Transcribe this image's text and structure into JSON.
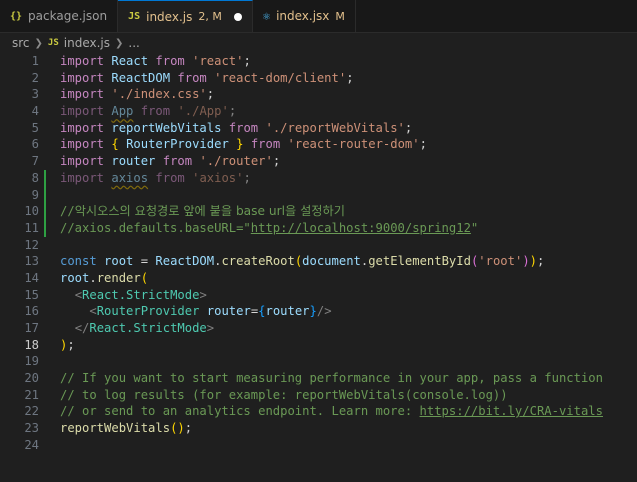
{
  "tabs": [
    {
      "icon": "{}",
      "label": "package.json",
      "badge": ""
    },
    {
      "icon": "JS",
      "label": "index.js",
      "badge": "2, M"
    },
    {
      "icon": "⚛",
      "label": "index.jsx",
      "badge": "M"
    }
  ],
  "breadcrumb": {
    "folder": "src",
    "file_icon": "JS",
    "file": "index.js",
    "more": "..."
  },
  "editor": {
    "current_line": "18",
    "lines": [
      {
        "n": "1",
        "t": [
          [
            "kw",
            "import"
          ],
          [
            "pun",
            " "
          ],
          [
            "id",
            "React"
          ],
          [
            "pun",
            " "
          ],
          [
            "kw",
            "from"
          ],
          [
            "pun",
            " "
          ],
          [
            "str",
            "'react'"
          ],
          [
            "pun",
            ";"
          ]
        ]
      },
      {
        "n": "2",
        "t": [
          [
            "kw",
            "import"
          ],
          [
            "pun",
            " "
          ],
          [
            "id",
            "ReactDOM"
          ],
          [
            "pun",
            " "
          ],
          [
            "kw",
            "from"
          ],
          [
            "pun",
            " "
          ],
          [
            "str",
            "'react-dom/client'"
          ],
          [
            "pun",
            ";"
          ]
        ]
      },
      {
        "n": "3",
        "t": [
          [
            "kw",
            "import"
          ],
          [
            "pun",
            " "
          ],
          [
            "str",
            "'./index.css'"
          ],
          [
            "pun",
            ";"
          ]
        ]
      },
      {
        "n": "4",
        "t": [
          [
            "kw dim",
            "import"
          ],
          [
            "pun dim",
            " "
          ],
          [
            "id dim squig",
            "App"
          ],
          [
            "pun dim",
            " "
          ],
          [
            "kw dim",
            "from"
          ],
          [
            "pun dim",
            " "
          ],
          [
            "str dim",
            "'./App'"
          ],
          [
            "pun dim",
            ";"
          ]
        ]
      },
      {
        "n": "5",
        "t": [
          [
            "kw",
            "import"
          ],
          [
            "pun",
            " "
          ],
          [
            "id",
            "reportWebVitals"
          ],
          [
            "pun",
            " "
          ],
          [
            "kw",
            "from"
          ],
          [
            "pun",
            " "
          ],
          [
            "str",
            "'./reportWebVitals'"
          ],
          [
            "pun",
            ";"
          ]
        ]
      },
      {
        "n": "6",
        "t": [
          [
            "kw",
            "import"
          ],
          [
            "pun",
            " "
          ],
          [
            "br1",
            "{"
          ],
          [
            "pun",
            " "
          ],
          [
            "id",
            "RouterProvider"
          ],
          [
            "pun",
            " "
          ],
          [
            "br1",
            "}"
          ],
          [
            "pun",
            " "
          ],
          [
            "kw",
            "from"
          ],
          [
            "pun",
            " "
          ],
          [
            "str",
            "'react-router-dom'"
          ],
          [
            "pun",
            ";"
          ]
        ]
      },
      {
        "n": "7",
        "t": [
          [
            "kw",
            "import"
          ],
          [
            "pun",
            " "
          ],
          [
            "id",
            "router"
          ],
          [
            "pun",
            " "
          ],
          [
            "kw",
            "from"
          ],
          [
            "pun",
            " "
          ],
          [
            "str",
            "'./router'"
          ],
          [
            "pun",
            ";"
          ]
        ]
      },
      {
        "n": "8",
        "added": true,
        "t": [
          [
            "kw dim",
            "import"
          ],
          [
            "pun dim",
            " "
          ],
          [
            "id dim squig",
            "axios"
          ],
          [
            "pun dim",
            " "
          ],
          [
            "kw dim",
            "from"
          ],
          [
            "pun dim",
            " "
          ],
          [
            "str dim",
            "'axios'"
          ],
          [
            "pun dim",
            ";"
          ]
        ]
      },
      {
        "n": "9",
        "added": true,
        "t": []
      },
      {
        "n": "10",
        "added": true,
        "t": [
          [
            "cmt",
            "//"
          ],
          [
            "cmt cmt-ko",
            "악시오스의 요청경로 앞에 붙을 base url을 설정하기"
          ]
        ]
      },
      {
        "n": "11",
        "added": true,
        "t": [
          [
            "cmt",
            "//axios.defaults.baseURL=\""
          ],
          [
            "cmt link",
            "http://localhost:9000/spring12"
          ],
          [
            "cmt",
            "\""
          ]
        ]
      },
      {
        "n": "12",
        "t": []
      },
      {
        "n": "13",
        "t": [
          [
            "kwb",
            "const"
          ],
          [
            "pun",
            " "
          ],
          [
            "id",
            "root"
          ],
          [
            "pun",
            " = "
          ],
          [
            "id",
            "ReactDOM"
          ],
          [
            "pun",
            "."
          ],
          [
            "fn",
            "createRoot"
          ],
          [
            "br1",
            "("
          ],
          [
            "id",
            "document"
          ],
          [
            "pun",
            "."
          ],
          [
            "fn",
            "getElementById"
          ],
          [
            "br2",
            "("
          ],
          [
            "str",
            "'root'"
          ],
          [
            "br2",
            ")"
          ],
          [
            "br1",
            ")"
          ],
          [
            "pun",
            ";"
          ]
        ]
      },
      {
        "n": "14",
        "t": [
          [
            "id",
            "root"
          ],
          [
            "pun",
            "."
          ],
          [
            "fn",
            "render"
          ],
          [
            "br1",
            "("
          ]
        ]
      },
      {
        "n": "15",
        "t": [
          [
            "pun",
            "  "
          ],
          [
            "tagp",
            "<"
          ],
          [
            "tag",
            "React.StrictMode"
          ],
          [
            "tagp",
            ">"
          ]
        ]
      },
      {
        "n": "16",
        "t": [
          [
            "pun",
            "    "
          ],
          [
            "tagp",
            "<"
          ],
          [
            "tag",
            "RouterProvider"
          ],
          [
            "pun",
            " "
          ],
          [
            "id",
            "router"
          ],
          [
            "pun",
            "="
          ],
          [
            "br3",
            "{"
          ],
          [
            "id",
            "router"
          ],
          [
            "br3",
            "}"
          ],
          [
            "tagp",
            "/>"
          ]
        ]
      },
      {
        "n": "17",
        "t": [
          [
            "pun",
            "  "
          ],
          [
            "tagp",
            "</"
          ],
          [
            "tag",
            "React.StrictMode"
          ],
          [
            "tagp",
            ">"
          ]
        ]
      },
      {
        "n": "18",
        "t": [
          [
            "br1",
            ")"
          ],
          [
            "pun",
            ";"
          ]
        ]
      },
      {
        "n": "19",
        "t": []
      },
      {
        "n": "20",
        "t": [
          [
            "cmt",
            "// If you want to start measuring performance in your app, pass a function"
          ]
        ]
      },
      {
        "n": "21",
        "t": [
          [
            "cmt",
            "// to log results (for example: reportWebVitals(console.log))"
          ]
        ]
      },
      {
        "n": "22",
        "t": [
          [
            "cmt",
            "// or send to an analytics endpoint. Learn more: "
          ],
          [
            "cmt link",
            "https://bit.ly/CRA-vitals"
          ]
        ]
      },
      {
        "n": "23",
        "t": [
          [
            "fn",
            "reportWebVitals"
          ],
          [
            "br1",
            "()"
          ],
          [
            "pun",
            ";"
          ]
        ]
      },
      {
        "n": "24",
        "t": []
      }
    ]
  }
}
